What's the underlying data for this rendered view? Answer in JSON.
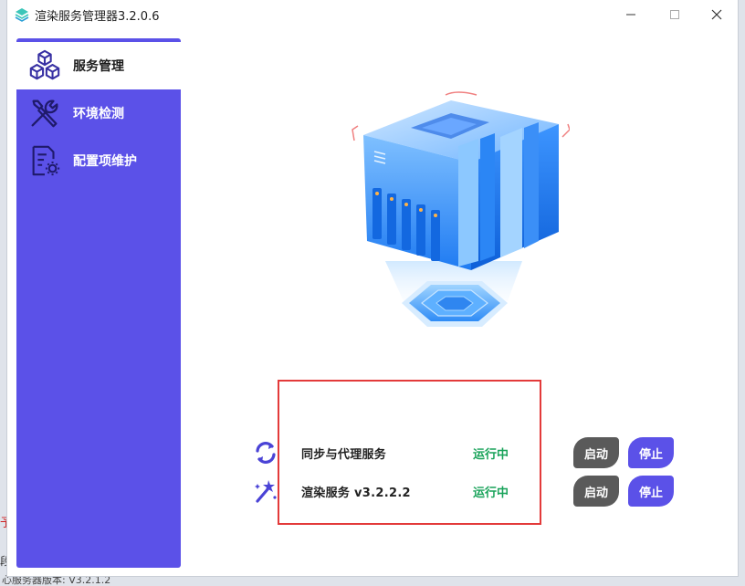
{
  "window": {
    "title": "渲染服务管理器3.2.0.6"
  },
  "sidebar": {
    "items": [
      {
        "label": "服务管理",
        "icon": "cubes-icon",
        "active": true
      },
      {
        "label": "环境检测",
        "icon": "tools-icon",
        "active": false
      },
      {
        "label": "配置项维护",
        "icon": "config-doc-icon",
        "active": false
      }
    ]
  },
  "services": [
    {
      "name": "同步与代理服务",
      "status": "运行中",
      "icon": "sync-icon",
      "start_label": "启动",
      "stop_label": "停止"
    },
    {
      "name": "渲染服务 v3.2.2.2",
      "status": "运行中",
      "icon": "magic-wand-icon",
      "start_label": "启动",
      "stop_label": "停止"
    }
  ],
  "background_window": {
    "version_text": "心服务器版本: V3.2.1.2",
    "edge_char_1": "予",
    "edge_char_2": "段"
  },
  "colors": {
    "accent": "#5b51e8",
    "start_button": "#5a5a5a",
    "status_running": "#19a35a",
    "highlight_border": "#e33a3a"
  }
}
